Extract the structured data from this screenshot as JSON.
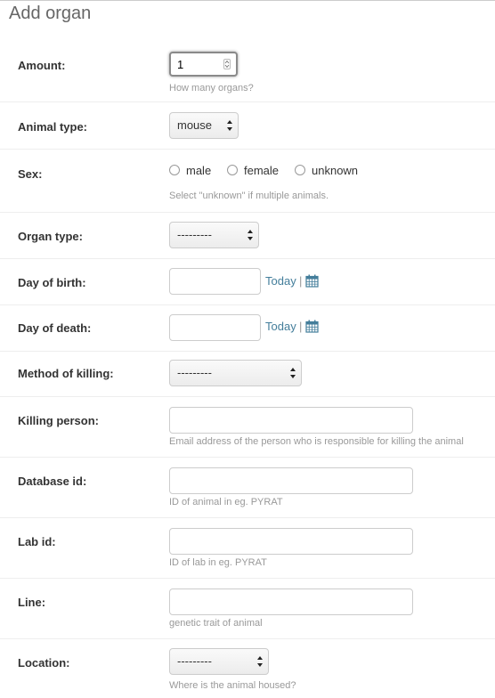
{
  "page": {
    "title": "Add organ"
  },
  "amount": {
    "label": "Amount:",
    "value": "1",
    "help": "How many organs?"
  },
  "animal_type": {
    "label": "Animal type:",
    "selected": "mouse"
  },
  "sex": {
    "label": "Sex:",
    "options": [
      "male",
      "female",
      "unknown"
    ],
    "help": "Select \"unknown\" if multiple animals."
  },
  "organ_type": {
    "label": "Organ type:",
    "selected": "---------"
  },
  "day_of_birth": {
    "label": "Day of birth:",
    "today": "Today",
    "sep": "|"
  },
  "day_of_death": {
    "label": "Day of death:",
    "today": "Today",
    "sep": "|"
  },
  "method_of_killing": {
    "label": "Method of killing:",
    "selected": "---------"
  },
  "killing_person": {
    "label": "Killing person:",
    "help": "Email address of the person who is responsible for killing the animal"
  },
  "database_id": {
    "label": "Database id:",
    "help": "ID of animal in eg. PYRAT"
  },
  "lab_id": {
    "label": "Lab id:",
    "help": "ID of lab in eg. PYRAT"
  },
  "line": {
    "label": "Line:",
    "help": "genetic trait of animal"
  },
  "location": {
    "label": "Location:",
    "selected": "---------",
    "help": "Where is the animal housed?"
  },
  "colors": {
    "link": "#447e9b",
    "help_text": "#999999",
    "border": "#cccccc"
  },
  "icons": {
    "calendar": "calendar-icon"
  }
}
